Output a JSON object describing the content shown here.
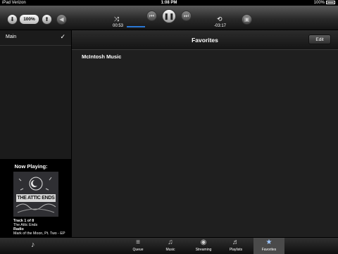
{
  "status_bar": {
    "carrier": "iPad Verizon",
    "time": "1:08 PM",
    "battery": "100%"
  },
  "transport": {
    "volume": "100%",
    "elapsed": "00:53",
    "remaining": "-03:17",
    "progress_fraction": 0.22
  },
  "sidebar": {
    "items": [
      {
        "label": "Main",
        "check": "✓"
      }
    ]
  },
  "main": {
    "title": "Favorites",
    "edit_label": "Edit",
    "items": [
      "McIntosh Music"
    ]
  },
  "now_playing": {
    "header": "Now Playing:",
    "album_art_text": "THE ATTIC ENDS",
    "track": "Track 1 of 8",
    "artist": "The Attic Ends",
    "source": "Radio",
    "album": "Mark of the Moon, Pt. Two - EP"
  },
  "tabs": [
    {
      "label": "Queue",
      "icon": "queue-icon"
    },
    {
      "label": "Music",
      "icon": "music-note-icon"
    },
    {
      "label": "Streaming",
      "icon": "streaming-icon"
    },
    {
      "label": "Playlists",
      "icon": "playlists-icon"
    },
    {
      "label": "Favorites",
      "icon": "star-icon",
      "active": true
    }
  ],
  "colors": {
    "accent": "#2a78d6",
    "active_tab_icon": "#9fc8ff"
  }
}
